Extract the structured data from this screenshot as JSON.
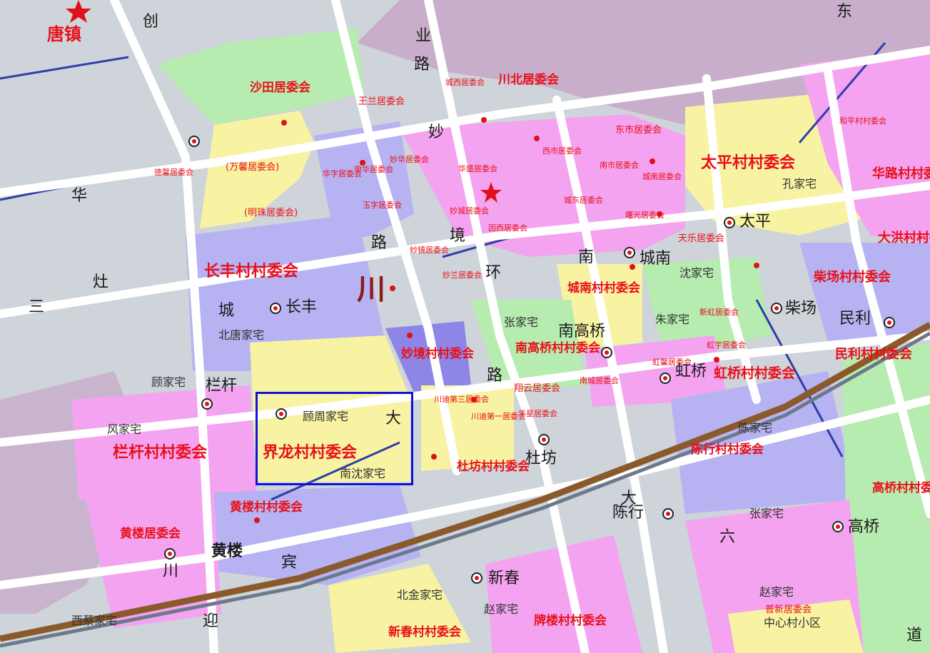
{
  "map": {
    "title": "唐镇",
    "highlight_label": "界龙村村委会",
    "colors": {
      "residential_pink": "#f4a3f0",
      "village_purple": "#b7b2f2",
      "green": "#b6ecb0",
      "yellow": "#f8f3a2",
      "road": "#ffffff",
      "label_red": "#e8101a",
      "highlight_box": "#1010e0",
      "railway": "#8b5a2b"
    },
    "committees_large": [
      "沙田居委会",
      "长丰村村委会",
      "太平村村委会",
      "华路村村委会",
      "大洪村村委会",
      "柴场村村委会",
      "民利村村委会",
      "城南村村委会",
      "南高桥村村委会",
      "妙境村村委会",
      "虹桥村村委会",
      "栏杆村村委会",
      "界龙村村委会",
      "杜坊村村委会",
      "陈行村村委会",
      "黄楼村村委会",
      "黄楼居委会",
      "高桥村村委会",
      "新春村村委会",
      "牌楼村村委会",
      "川北居委会",
      "普新居委会"
    ],
    "committees_small": [
      "王兰居委会",
      "城西居委会",
      "徳馨居委会",
      "(万馨居委会)",
      "(明珠居委会)",
      "华字居委会",
      "甲华居委会",
      "妙华居委会",
      "玉字居委会",
      "华盛居委会",
      "东市居委会",
      "西市居委会",
      "南市居委会",
      "城南居委会",
      "城东居委会",
      "曙光居委会",
      "妙城居委会",
      "因西居委会",
      "妙镜居委会",
      "妙兰居委会",
      "天乐居委会",
      "新虹居委会",
      "虹宇居委会",
      "虹馨居委会",
      "翔云居委会",
      "川迪第三居委会",
      "川迪第一居委会",
      "华星居委会",
      "南城居委会",
      "和平村村委会"
    ],
    "road_names": [
      "东",
      "华",
      "创",
      "业",
      "路",
      "妙",
      "境",
      "路",
      "城",
      "环",
      "南",
      "大",
      "路",
      "灶",
      "三",
      "川",
      "六",
      "迎",
      "宾",
      "大",
      "道"
    ],
    "places": [
      "北唐家宅",
      "顾家宅",
      "风家宅",
      "顾周家宅",
      "南沈家宅",
      "张家宅",
      "沈家宅",
      "朱家宅",
      "孔家宅",
      "张家宅",
      "陈家宅",
      "赵家宅",
      "北金家宅",
      "赵家宅",
      "西蔡家宅",
      "中心村小区"
    ],
    "stations": [
      "长丰",
      "太平",
      "城南",
      "柴场",
      "民利",
      "南高桥",
      "虹桥",
      "栏杆",
      "杜坊",
      "陈行",
      "高桥",
      "黄楼",
      "新春",
      "唐镇"
    ],
    "big_char": "川"
  }
}
